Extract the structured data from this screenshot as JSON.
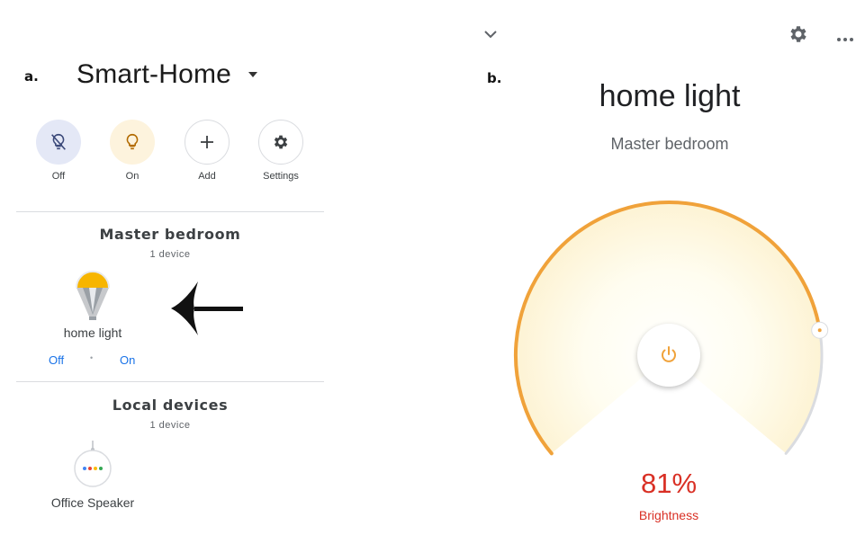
{
  "panel_a": {
    "label": "a.",
    "home_title": "Smart-Home",
    "quick_actions": [
      {
        "label": "Off",
        "icon": "light-off-icon"
      },
      {
        "label": "On",
        "icon": "lightbulb-icon"
      },
      {
        "label": "Add",
        "icon": "plus-icon"
      },
      {
        "label": "Settings",
        "icon": "gear-icon"
      }
    ],
    "rooms": [
      {
        "title": "Master bedroom",
        "device_count": "1 device",
        "device": {
          "name": "home light",
          "icon": "smart-bulb-icon"
        },
        "controls": {
          "off": "Off",
          "separator": "•",
          "on": "On"
        }
      },
      {
        "title": "Local devices",
        "device_count": "1 device",
        "device": {
          "name": "Office Speaker",
          "icon": "speaker-icon"
        }
      }
    ],
    "annotation": "arrow-left-icon"
  },
  "panel_b": {
    "label": "b.",
    "device_title": "home light",
    "room": "Master bedroom",
    "brightness": {
      "value_text": "81%",
      "label": "Brightness",
      "level": 0.81
    },
    "icons": [
      "chevron-down-icon",
      "gear-icon",
      "more-icon",
      "power-icon"
    ]
  },
  "colors": {
    "accent_orange": "#f0a23a",
    "brightness_red": "#d93025",
    "link_blue": "#1a73e8",
    "off_bg": "#e4e8f6",
    "on_bg": "#fdf3dd"
  }
}
